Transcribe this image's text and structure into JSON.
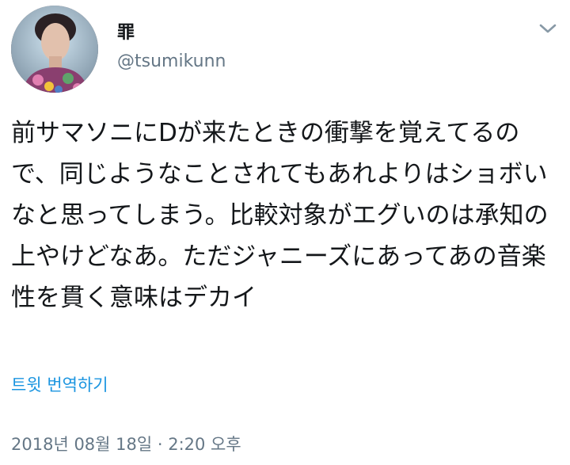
{
  "user": {
    "display_name": "罪",
    "handle": "@tsumikunn"
  },
  "tweet": {
    "text": "前サマソニにDが来たときの衝撃を覚えてるので、同じようなことされてもあれよりはショボいなと思ってしまう。比較対象がエグいのは承知の上やけどなあ。ただジャニーズにあってあの音楽性を貫く意味はデカイ",
    "translate_label": "트윗 번역하기",
    "timestamp": "2018년 08월 18일 · 2:20 오후"
  },
  "icons": {
    "menu": "chevron-down-icon",
    "avatar": "avatar"
  },
  "colors": {
    "text": "#14171a",
    "secondary": "#657786",
    "link": "#1b95e0"
  }
}
